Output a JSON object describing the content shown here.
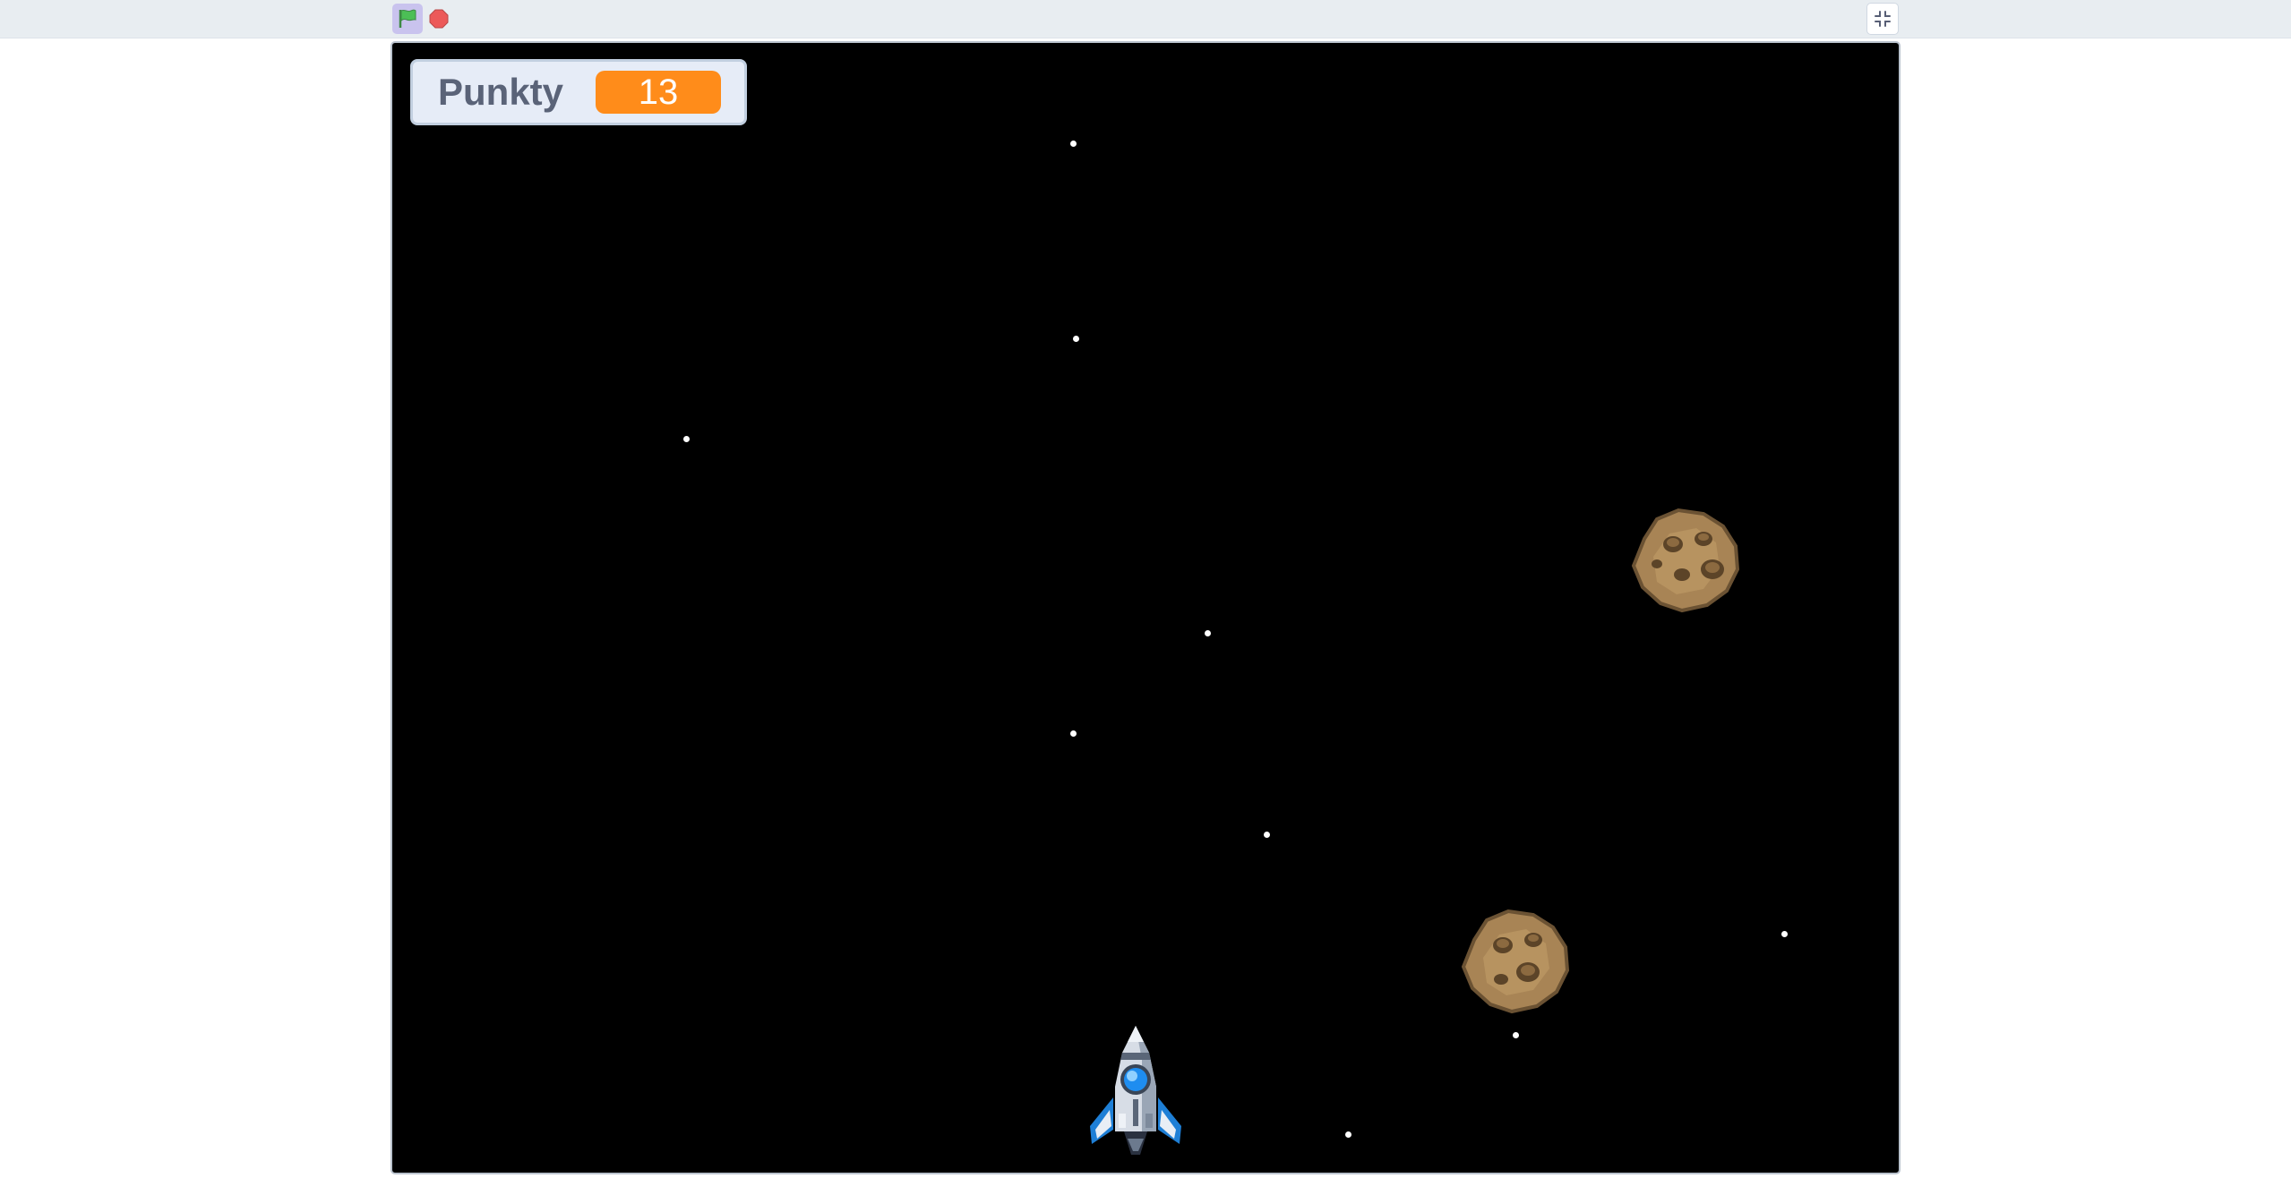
{
  "toolbar": {
    "green_flag_icon": "green-flag-icon",
    "stop_icon": "stop-sign-icon",
    "fullscreen_exit_icon": "exit-fullscreen-icon",
    "flag_color": "#4cbf56",
    "stop_color": "#ec5959"
  },
  "monitor": {
    "label": "Punkty",
    "value": "13",
    "value_color": "#ff8c1a"
  },
  "stage": {
    "background_color": "#000000",
    "sprites": [
      "rocket-ship",
      "asteroid",
      "asteroid"
    ]
  }
}
